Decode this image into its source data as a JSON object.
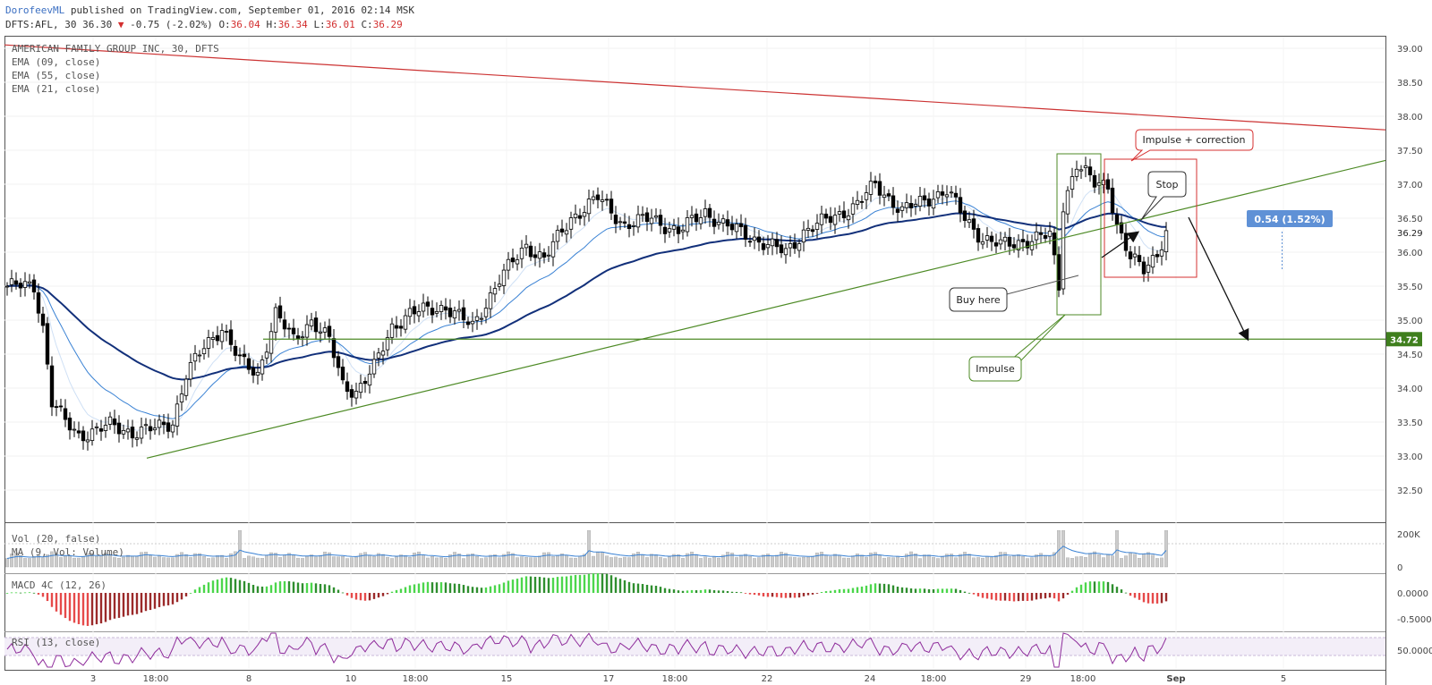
{
  "header": {
    "author": "DorofeevML",
    "published": "published on TradingView.com, September 01, 2016 02:14 MSK",
    "symbol_line_prefix": "DFTS:AFL, 30 36.30",
    "change": "-0.75 (-2.02%)",
    "o_label": "O:",
    "o_value": "36.04",
    "h_label": "H:",
    "h_value": "36.34",
    "l_label": "L:",
    "l_value": "36.01",
    "c_label": "C:",
    "c_value": "36.29"
  },
  "legend": {
    "symbol": "AMERICAN FAMILY GROUP INC, 30, DFTS",
    "ema9": "EMA (09, close)",
    "ema55": "EMA (55, close)",
    "ema21": "EMA (21, close)"
  },
  "colors": {
    "up_candle": "#ffffff",
    "down_candle": "#000000",
    "ema_fast": "#cfe0f5",
    "ema_mid": "#3a82d4",
    "ema_slow": "#12307a",
    "resistance": "#cc3333",
    "support": "#4d8a25",
    "macd_pos": "#4cd64c",
    "macd_neg": "#e64a4a",
    "rsi": "#8e2c9b",
    "volume": "#cccccc"
  },
  "annotations": {
    "impulse_correction": "Impulse + correction",
    "stop": "Stop",
    "buy_here": "Buy here",
    "impulse": "Impulse",
    "measure": "0.54 (1.52%)"
  },
  "price_axis": {
    "ticks": [
      "39.00",
      "38.50",
      "38.00",
      "37.50",
      "37.00",
      "36.50",
      "36.00",
      "35.50",
      "35.00",
      "34.50",
      "34.00",
      "33.50",
      "33.00",
      "32.50"
    ],
    "current_price": "36.29",
    "level_label": "34.72"
  },
  "time_axis": {
    "ticks": [
      "3",
      "18:00",
      "8",
      "10",
      "18:00",
      "15",
      "17",
      "18:00",
      "22",
      "24",
      "18:00",
      "29",
      "18:00",
      "Sep",
      "5"
    ]
  },
  "volume_panel": {
    "label1": "Vol (20, false)",
    "label2": "MA (9, Vol: Volume)",
    "ticks": [
      "200K",
      "0"
    ]
  },
  "macd_panel": {
    "label": "MACD 4C (12, 26)",
    "ticks": [
      "0.0000",
      "-0.5000"
    ]
  },
  "rsi_panel": {
    "label": "RSI (13, close)",
    "ticks": [
      "50.0000"
    ]
  },
  "chart_data": {
    "type": "candlestick",
    "ylim": [
      32.2,
      39.2
    ],
    "ema_series": [
      "EMA (09, close)",
      "EMA (55, close)",
      "EMA (21, close)"
    ],
    "trendlines": [
      {
        "kind": "resistance",
        "from": 39.05,
        "to": 37.8
      },
      {
        "kind": "support",
        "from": 32.97,
        "to": 37.35
      },
      {
        "kind": "horizontal",
        "value": 34.72
      }
    ],
    "anchors": [
      {
        "i": 0,
        "c": 35.5
      },
      {
        "i": 6,
        "c": 35.5
      },
      {
        "i": 8,
        "c": 34.9
      },
      {
        "i": 10,
        "c": 33.8
      },
      {
        "i": 13,
        "c": 33.5
      },
      {
        "i": 16,
        "c": 33.3
      },
      {
        "i": 23,
        "c": 33.45
      },
      {
        "i": 28,
        "c": 33.35
      },
      {
        "i": 33,
        "c": 33.4
      },
      {
        "i": 37,
        "c": 33.5
      },
      {
        "i": 40,
        "c": 34.2
      },
      {
        "i": 44,
        "c": 34.6
      },
      {
        "i": 48,
        "c": 34.9
      },
      {
        "i": 52,
        "c": 34.4
      },
      {
        "i": 56,
        "c": 34.2
      },
      {
        "i": 60,
        "c": 35.1
      },
      {
        "i": 64,
        "c": 34.7
      },
      {
        "i": 68,
        "c": 35.0
      },
      {
        "i": 72,
        "c": 34.7
      },
      {
        "i": 75,
        "c": 34.05
      },
      {
        "i": 78,
        "c": 33.95
      },
      {
        "i": 82,
        "c": 34.3
      },
      {
        "i": 86,
        "c": 34.9
      },
      {
        "i": 90,
        "c": 35.1
      },
      {
        "i": 98,
        "c": 35.2
      },
      {
        "i": 104,
        "c": 34.9
      },
      {
        "i": 110,
        "c": 35.6
      },
      {
        "i": 116,
        "c": 36.1
      },
      {
        "i": 120,
        "c": 35.9
      },
      {
        "i": 126,
        "c": 36.5
      },
      {
        "i": 132,
        "c": 36.8
      },
      {
        "i": 138,
        "c": 36.4
      },
      {
        "i": 144,
        "c": 36.5
      },
      {
        "i": 150,
        "c": 36.3
      },
      {
        "i": 156,
        "c": 36.6
      },
      {
        "i": 160,
        "c": 36.4
      },
      {
        "i": 164,
        "c": 36.3
      },
      {
        "i": 170,
        "c": 36.1
      },
      {
        "i": 174,
        "c": 36.0
      },
      {
        "i": 178,
        "c": 36.3
      },
      {
        "i": 184,
        "c": 36.5
      },
      {
        "i": 190,
        "c": 36.7
      },
      {
        "i": 194,
        "c": 37.0
      },
      {
        "i": 200,
        "c": 36.6
      },
      {
        "i": 206,
        "c": 36.8
      },
      {
        "i": 210,
        "c": 36.9
      },
      {
        "i": 214,
        "c": 36.5
      },
      {
        "i": 218,
        "c": 36.2
      },
      {
        "i": 222,
        "c": 36.1
      },
      {
        "i": 226,
        "c": 36.15
      },
      {
        "i": 230,
        "c": 36.2
      },
      {
        "i": 233,
        "c": 36.25
      },
      {
        "i": 235,
        "c": 35.5
      },
      {
        "i": 236,
        "c": 36.7
      },
      {
        "i": 239,
        "c": 37.3
      },
      {
        "i": 243,
        "c": 37.0
      },
      {
        "i": 246,
        "c": 37.0
      },
      {
        "i": 248,
        "c": 36.4
      },
      {
        "i": 251,
        "c": 35.9
      },
      {
        "i": 254,
        "c": 35.75
      },
      {
        "i": 257,
        "c": 36.0
      },
      {
        "i": 259,
        "c": 36.29
      }
    ],
    "volume_ylim": [
      0,
      250000
    ]
  }
}
